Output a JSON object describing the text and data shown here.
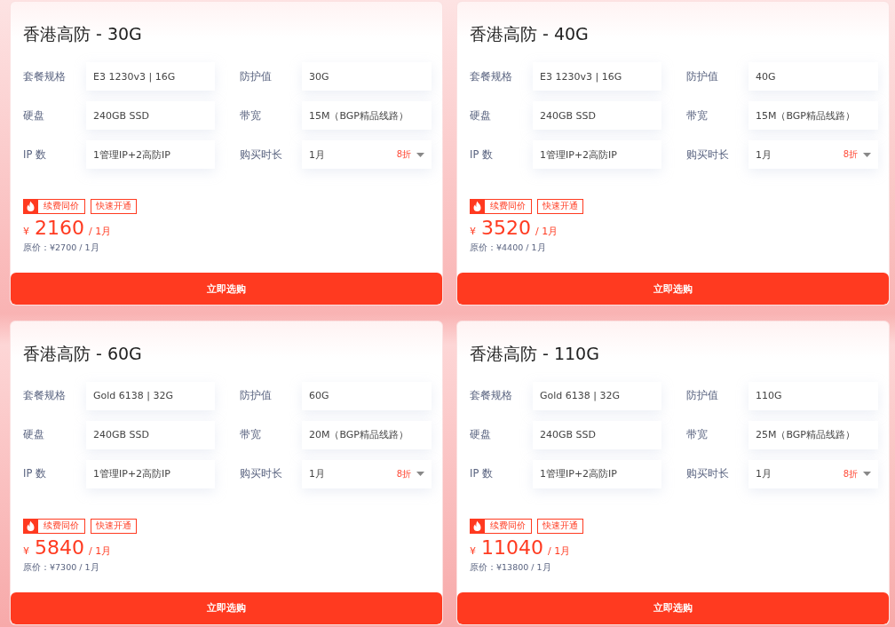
{
  "cards": [
    {
      "title": "香港高防 - 30G",
      "fields": [
        {
          "label": "套餐规格",
          "value": "E3 1230v3 | 16G"
        },
        {
          "label": "防护值",
          "value": "30G"
        },
        {
          "label": "硬盘",
          "value": "240GB SSD"
        },
        {
          "label": "带宽",
          "value": "15M（BGP精品线路）"
        },
        {
          "label": "IP 数",
          "value": "1管理IP+2高防IP"
        },
        {
          "label": "购买时长",
          "value": "1月",
          "discount": "8折",
          "kind": "select"
        }
      ],
      "tags": [
        {
          "label": "续费同价",
          "kind": "hot"
        },
        {
          "label": "快速开通",
          "kind": "plain"
        }
      ],
      "currency": "¥",
      "price": "2160",
      "period": "/ 1月",
      "original_price": "原价：¥2700 / 1月",
      "button": "立即选购"
    },
    {
      "title": "香港高防 - 40G",
      "fields": [
        {
          "label": "套餐规格",
          "value": "E3 1230v3 | 16G"
        },
        {
          "label": "防护值",
          "value": "40G"
        },
        {
          "label": "硬盘",
          "value": "240GB SSD"
        },
        {
          "label": "带宽",
          "value": "15M（BGP精品线路）"
        },
        {
          "label": "IP 数",
          "value": "1管理IP+2高防IP"
        },
        {
          "label": "购买时长",
          "value": "1月",
          "discount": "8折",
          "kind": "select"
        }
      ],
      "tags": [
        {
          "label": "续费同价",
          "kind": "hot"
        },
        {
          "label": "快速开通",
          "kind": "plain"
        }
      ],
      "currency": "¥",
      "price": "3520",
      "period": "/ 1月",
      "original_price": "原价：¥4400 / 1月",
      "button": "立即选购"
    },
    {
      "title": "香港高防 - 60G",
      "fields": [
        {
          "label": "套餐规格",
          "value": "Gold 6138 | 32G"
        },
        {
          "label": "防护值",
          "value": "60G"
        },
        {
          "label": "硬盘",
          "value": "240GB SSD"
        },
        {
          "label": "带宽",
          "value": "20M（BGP精品线路）"
        },
        {
          "label": "IP 数",
          "value": "1管理IP+2高防IP"
        },
        {
          "label": "购买时长",
          "value": "1月",
          "discount": "8折",
          "kind": "select"
        }
      ],
      "tags": [
        {
          "label": "续费同价",
          "kind": "hot"
        },
        {
          "label": "快速开通",
          "kind": "plain"
        }
      ],
      "currency": "¥",
      "price": "5840",
      "period": "/ 1月",
      "original_price": "原价：¥7300 / 1月",
      "button": "立即选购"
    },
    {
      "title": "香港高防 - 110G",
      "fields": [
        {
          "label": "套餐规格",
          "value": "Gold 6138 | 32G"
        },
        {
          "label": "防护值",
          "value": "110G"
        },
        {
          "label": "硬盘",
          "value": "240GB SSD"
        },
        {
          "label": "带宽",
          "value": "25M（BGP精品线路）"
        },
        {
          "label": "IP 数",
          "value": "1管理IP+2高防IP"
        },
        {
          "label": "购买时长",
          "value": "1月",
          "discount": "8折",
          "kind": "select"
        }
      ],
      "tags": [
        {
          "label": "续费同价",
          "kind": "hot"
        },
        {
          "label": "快速开通",
          "kind": "plain"
        }
      ],
      "currency": "¥",
      "price": "11040",
      "period": "/ 1月",
      "original_price": "原价：¥13800 / 1月",
      "button": "立即选购"
    }
  ]
}
